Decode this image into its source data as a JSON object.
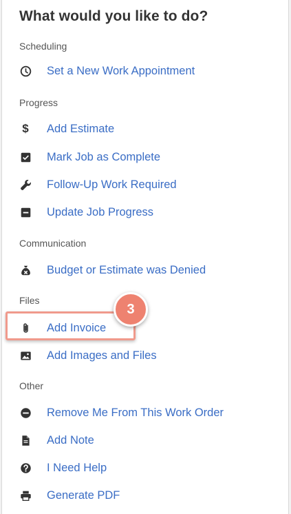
{
  "heading": "What would you like to do?",
  "sections": {
    "scheduling": {
      "label": "Scheduling",
      "items": [
        {
          "label": "Set a New Work Appointment",
          "icon": "clock-icon"
        }
      ]
    },
    "progress": {
      "label": "Progress",
      "items": [
        {
          "label": "Add Estimate",
          "icon": "dollar-icon"
        },
        {
          "label": "Mark Job as Complete",
          "icon": "checkbox-icon"
        },
        {
          "label": "Follow-Up Work Required",
          "icon": "wrench-icon"
        },
        {
          "label": "Update Job Progress",
          "icon": "minus-square-icon"
        }
      ]
    },
    "communication": {
      "label": "Communication",
      "items": [
        {
          "label": "Budget or Estimate was Denied",
          "icon": "money-bag-icon"
        }
      ]
    },
    "files": {
      "label": "Files",
      "items": [
        {
          "label": "Add Invoice",
          "icon": "paperclip-icon"
        },
        {
          "label": "Add Images and Files",
          "icon": "image-icon"
        }
      ]
    },
    "other": {
      "label": "Other",
      "items": [
        {
          "label": "Remove Me From This Work Order",
          "icon": "minus-circle-icon"
        },
        {
          "label": "Add Note",
          "icon": "file-icon"
        },
        {
          "label": "I Need Help",
          "icon": "question-circle-icon"
        },
        {
          "label": "Generate PDF",
          "icon": "printer-icon"
        }
      ]
    }
  },
  "callout": {
    "step": "3"
  },
  "colors": {
    "link": "#3a6dc5",
    "highlight": "#f09a8c",
    "badge": "#ee8270"
  }
}
